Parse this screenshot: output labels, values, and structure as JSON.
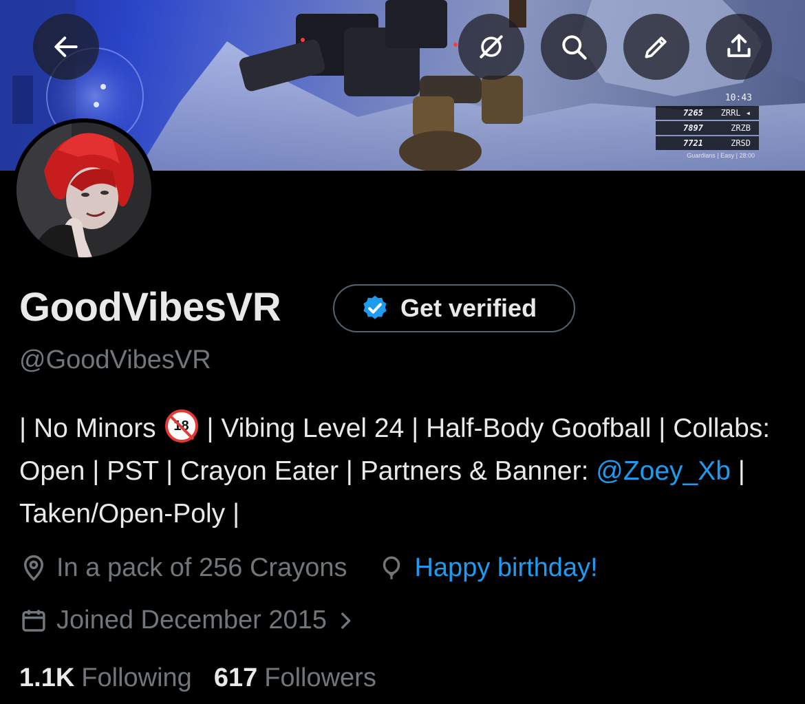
{
  "banner": {
    "hud": {
      "time": "10:43",
      "scores": [
        {
          "score": "7265",
          "tag": "ZRRL ◂"
        },
        {
          "score": "7897",
          "tag": "ZRZB"
        },
        {
          "score": "7721",
          "tag": "ZRSD"
        }
      ],
      "mode": "Guardians | Easy | 28:00"
    }
  },
  "toolbar": {
    "back_icon": "arrow-left-icon",
    "grok_icon": "grok-icon",
    "search_icon": "search-icon",
    "edit_icon": "pencil-icon",
    "share_icon": "share-icon"
  },
  "profile": {
    "display_name": "GoodVibesVR",
    "get_verified_label": "Get verified",
    "handle": "@GoodVibesVR",
    "bio": {
      "part1": "| No Minors ",
      "part2": " | Vibing Level 24 | Half-Body Goofball | Collabs: Open | PST | Crayon Eater | Partners & Banner: ",
      "mention": "@Zoey_Xb",
      "part3": " | Taken/Open-Poly |"
    },
    "location": "In a pack of 256 Crayons",
    "birthday": "Happy birthday!",
    "joined": "Joined December 2015",
    "following_count": "1.1K",
    "following_label": "Following",
    "followers_count": "617",
    "followers_label": "Followers"
  },
  "colors": {
    "accent": "#1d9bf0",
    "muted": "#71767b",
    "text": "#e7e9ea",
    "background": "#000000"
  }
}
